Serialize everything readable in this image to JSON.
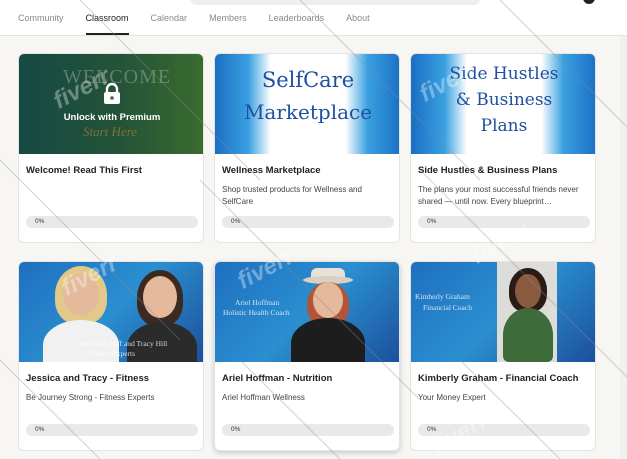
{
  "nav": {
    "items": [
      {
        "label": "Community"
      },
      {
        "label": "Classroom",
        "active": true
      },
      {
        "label": "Calendar"
      },
      {
        "label": "Members"
      },
      {
        "label": "Leaderboards"
      },
      {
        "label": "About"
      }
    ]
  },
  "courses": [
    {
      "title": "Welcome! Read This First",
      "description": "",
      "progress_label": "0%",
      "progress": 0,
      "cover": {
        "welcome_text": "WELCOME",
        "script_text": "Start Here",
        "locked_label": "Unlock with Premium",
        "icon": "lock-icon"
      }
    },
    {
      "title": "Wellness Marketplace",
      "description": "Shop trusted products for Wellness and SelfCare",
      "progress_label": "0%",
      "progress": 0,
      "cover": {
        "line1": "SelfCare",
        "line2": "Marketplace"
      }
    },
    {
      "title": "Side Hustles & Business Plans",
      "description": "The plans your most successful friends never shared — until now. Every blueprint…",
      "progress_label": "0%",
      "progress": 0,
      "cover": {
        "line1": "Side Hustles",
        "line2": "& Business",
        "line3": "Plans"
      }
    },
    {
      "title": "Jessica and Tracy - Fitness",
      "description": "Be Journey Strong - Fitness Experts",
      "progress_label": "0%",
      "progress": 0,
      "cover": {
        "caption1": "Jessica McNiff and Tracy Hill",
        "caption2": "Fitness Experts"
      }
    },
    {
      "title": "Ariel Hoffman - Nutrition",
      "description": "Ariel Hoffman Wellness",
      "progress_label": "0%",
      "progress": 0,
      "cover": {
        "caption1": "Ariel Hoffman",
        "caption2": "Holistic Health Coach"
      }
    },
    {
      "title": "Kimberly Graham - Financial Coach",
      "description": "Your Money Expert",
      "progress_label": "0%",
      "progress": 0,
      "cover": {
        "caption1": "Kimberly Graham",
        "caption2": "Financial Coach"
      }
    }
  ],
  "watermark": "fiverr",
  "colors": {
    "accent": "#202124",
    "cover_blue": "#1a6fc4",
    "welcome_green": "#2f6b48"
  }
}
